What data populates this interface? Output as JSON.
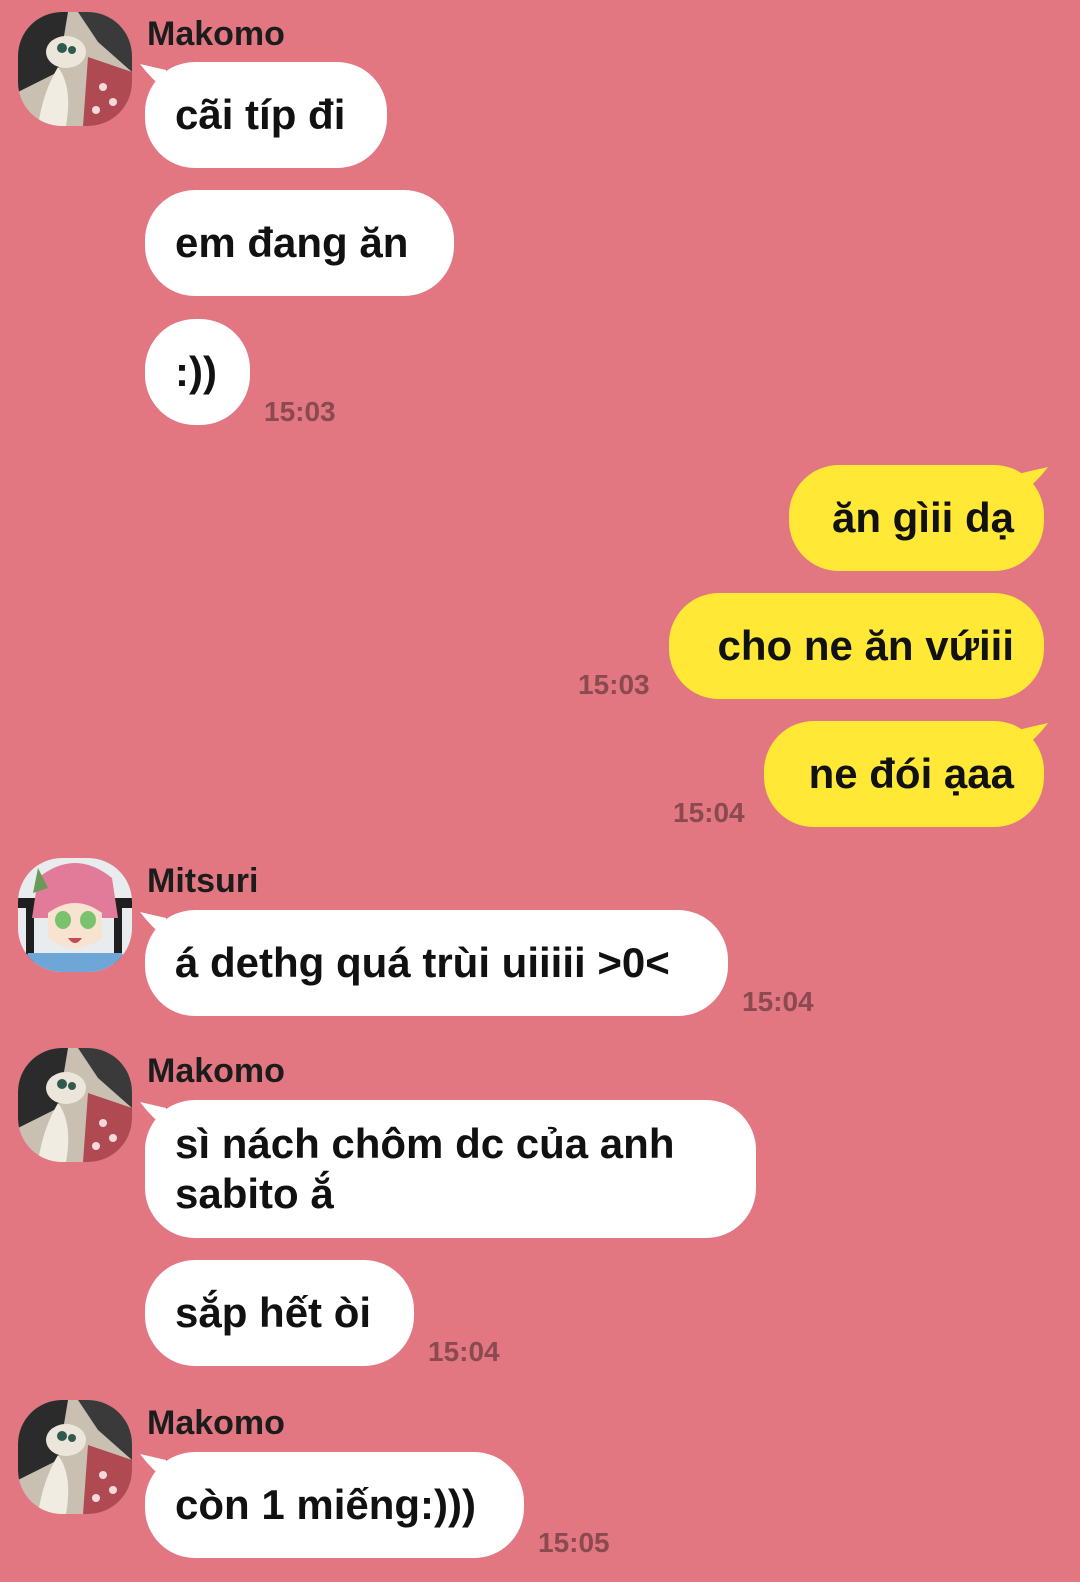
{
  "colors": {
    "background": "#e27782",
    "incoming_bubble": "#ffffff",
    "outgoing_bubble": "#ffe936",
    "timestamp": "#8a4a4f"
  },
  "messages": {
    "g1": {
      "sender": "Makomo",
      "m1": "cãi típ đi",
      "m2": "em đang ăn",
      "m3": ":))",
      "time": "15:03"
    },
    "o1": {
      "m1": "ăn gìii dạ",
      "m2": "cho ne ăn vứiii",
      "time2": "15:03",
      "m3": "ne đói ạaa",
      "time3": "15:04"
    },
    "g2": {
      "sender": "Mitsuri",
      "m1": "á dethg quá trùi uiiiii >0<",
      "time": "15:04"
    },
    "g3": {
      "sender": "Makomo",
      "m1": "sì nách chôm dc của anh sabito ắ",
      "m2": "sắp hết òi",
      "time": "15:04"
    },
    "g4": {
      "sender": "Makomo",
      "m1": "còn 1 miếng:)))",
      "time": "15:05"
    }
  },
  "icons": {
    "makomo_avatar": "makomo-avatar",
    "mitsuri_avatar": "mitsuri-avatar"
  }
}
